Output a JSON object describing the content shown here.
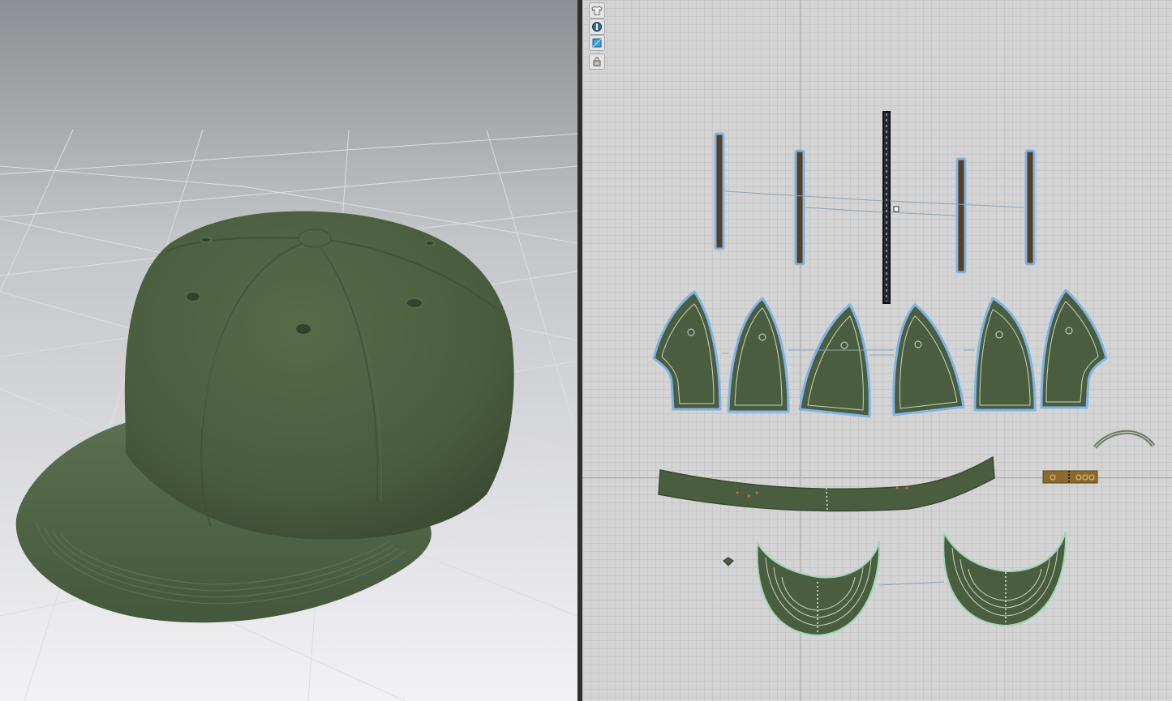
{
  "app": {
    "views": [
      "3d-avatar-window",
      "2d-pattern-window"
    ]
  },
  "garment": {
    "type": "baseball cap",
    "fabric_color": "#4b5d3f",
    "fabric_shadow": "#3c4b33",
    "pieces": [
      "crown-panel-1",
      "crown-panel-2",
      "crown-panel-3",
      "crown-panel-4",
      "crown-panel-5",
      "crown-panel-6",
      "seam-tape-1",
      "seam-tape-2",
      "seam-tape-3",
      "seam-tape-4",
      "seam-tape-5",
      "sweatband",
      "snap-closure",
      "snap-strap",
      "button-top",
      "visor-top",
      "visor-bottom"
    ]
  },
  "toolbar": {
    "tools": [
      {
        "icon": "shirt-display-icon"
      },
      {
        "icon": "avatar-display-icon"
      },
      {
        "icon": "texture-display-icon"
      },
      {
        "icon": "lock-icon"
      }
    ]
  },
  "colors": {
    "seam_tape": "#5a3e22",
    "selection_outline": "#7fb4e6",
    "visor_outline": "#9fd6b8",
    "closure": "#8a6b2c",
    "viewport_top": "#8d8e93",
    "viewport_bottom": "#f0f0f3"
  }
}
